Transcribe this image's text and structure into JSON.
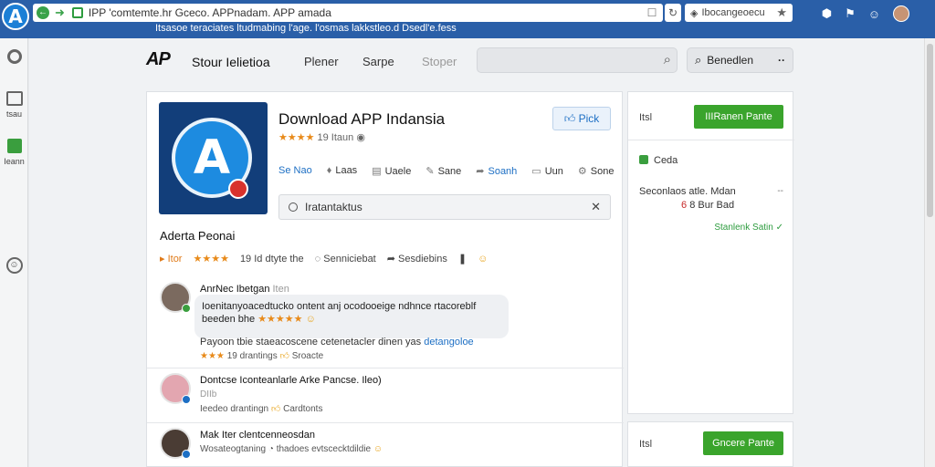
{
  "browser": {
    "url": "IPP 'comtemte.hr Gceco. APPnadam. APP amada",
    "bookmarks": "Itsasoe teraciates ltudmabing l'age. l'osmas lakkstleo.d Dsedl'e.fess",
    "extension_label": "Ibocangeoecu",
    "logo_glyph": "A"
  },
  "rail": {
    "item1_label": "tsau",
    "item2_label": "Ieann"
  },
  "topnav": {
    "brand": "AP",
    "store": "Stour Ielietioa",
    "planer": "Plener",
    "shape": "Sarpe",
    "super": "Stoper",
    "account": "Benedlen",
    "account_more": "··"
  },
  "app": {
    "title": "Download APP Indansia",
    "stars": "★★★★",
    "rating_text": "19 Itaun",
    "pick_label": "Pick",
    "actions": [
      {
        "icon": "▸",
        "label": "Se Nao"
      },
      {
        "icon": "♦",
        "label": "Laas"
      },
      {
        "icon": "▤",
        "label": "Uaele"
      },
      {
        "icon": "✎",
        "label": "Sane"
      },
      {
        "icon": "➦",
        "label": "Soanh"
      },
      {
        "icon": "▭",
        "label": "Uun"
      },
      {
        "icon": "⚙",
        "label": "Sone"
      }
    ],
    "filter_text": "Iratantaktus"
  },
  "reviews_section": {
    "title": "Aderta Peonai",
    "meta_tag": "Itor",
    "meta_stars": "★★★★",
    "meta_count": "19 Id dtyte the",
    "meta_action1": "Senniciebat",
    "meta_action2": "Sesdiebins"
  },
  "reviews": [
    {
      "name": "AnrNec Ibetgan",
      "name_muted": "Iten",
      "bubble_line1": "Ioenitanyoacedtucko ontent anj ocodooeige ndhnce rtacoreblf",
      "bubble_line2": "beeden  bhe",
      "bubble_stars": "★★★★★",
      "body": "Payoon tbie staeacoscene cetenetacler dinen yas",
      "body_link": "detangoloe",
      "sub_stars": "★★★",
      "sub_text": "19 drantings",
      "sub_action": "Sroacte"
    },
    {
      "name": "Dontcse Iconteanlarle Arke Pancse. Ileo)",
      "sub_tag": "DIIb",
      "sub_text": "Ieedeo drantingn",
      "sub_action": "Cardtonts"
    },
    {
      "name": "Mak Iter clentcenneosdan",
      "sub_text": "Wosateogtaning",
      "sub_action": "thadoes evtscecktdildie"
    }
  ],
  "sidebar": {
    "head_label": "Itsl",
    "head_button": "IIIRanen Pante",
    "item1": "Ceda",
    "item2": "Seconlaos atle. Mdan",
    "item2_more": "--",
    "item3": "8 Bur Bad",
    "item3_prefix": "6",
    "link": "Stanlenk Satin",
    "footer_label": "Itsl",
    "footer_button": "Gncere Pante"
  },
  "colors": {
    "chrome": "#2a5fa8",
    "accent_green": "#3aa42c",
    "link_blue": "#1d6fc4",
    "star_orange": "#e88a1a"
  }
}
